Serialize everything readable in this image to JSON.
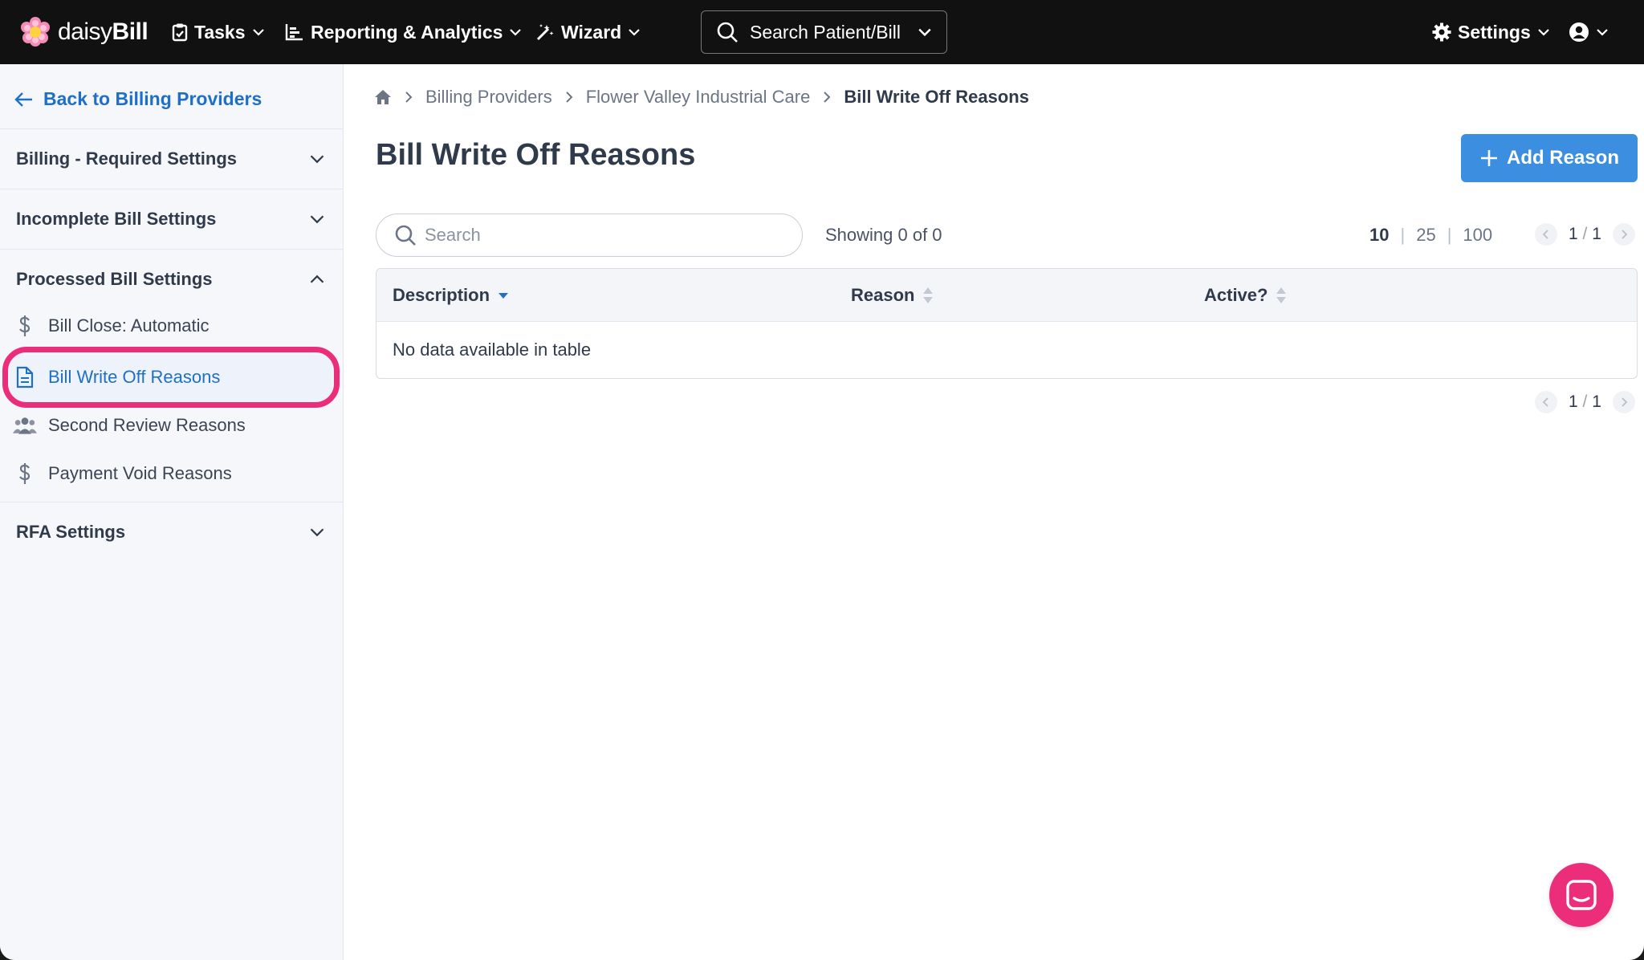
{
  "app": {
    "logo_light": "daisy",
    "logo_bold": "Bill"
  },
  "nav": {
    "tasks": "Tasks",
    "reporting": "Reporting & Analytics",
    "wizard": "Wizard",
    "search_label": "Search Patient/Bill",
    "settings": "Settings"
  },
  "sidebar": {
    "back_label": "Back to Billing Providers",
    "sections": [
      {
        "label": "Billing - Required Settings"
      },
      {
        "label": "Incomplete Bill Settings"
      },
      {
        "label": "Processed Bill Settings"
      },
      {
        "label": "RFA Settings"
      }
    ],
    "processed_items": [
      {
        "label": "Bill Close: Automatic",
        "icon": "dollar-icon"
      },
      {
        "label": "Bill Write Off Reasons",
        "icon": "document-icon"
      },
      {
        "label": "Second Review Reasons",
        "icon": "users-icon"
      },
      {
        "label": "Payment Void Reasons",
        "icon": "dollar-icon"
      }
    ]
  },
  "breadcrumb": {
    "items": [
      "Billing Providers",
      "Flower Valley Industrial Care"
    ],
    "current": "Bill Write Off Reasons"
  },
  "page": {
    "title": "Bill Write Off Reasons",
    "add_button": "Add Reason"
  },
  "table": {
    "search_placeholder": "Search",
    "showing": "Showing 0 of 0",
    "page_sizes": [
      "10",
      "25",
      "100"
    ],
    "selected_page_size": "10",
    "page_current": "1",
    "page_total": "1",
    "columns": [
      "Description",
      "Reason",
      "Active?"
    ],
    "empty_message": "No data available in table"
  },
  "colors": {
    "accent": "#1e6fc9",
    "button": "#3b8ee0",
    "highlight": "#ec2d7a",
    "topbar": "#111111"
  }
}
